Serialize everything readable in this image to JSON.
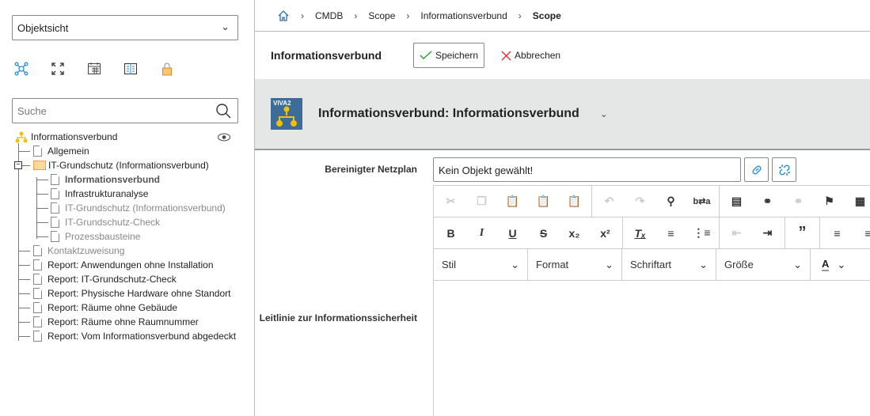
{
  "sidebar": {
    "view_select": "Objektsicht",
    "search_placeholder": "Suche",
    "tools": [
      "network-icon",
      "fullscreen-icon",
      "calendar-icon",
      "book-icon",
      "lock-icon"
    ],
    "tree": {
      "root": "Informationsverbund",
      "items": [
        {
          "label": "Allgemein",
          "level": 1,
          "style": "normal"
        },
        {
          "label": "IT-Grundschutz (Informationsverbund)",
          "level": 1,
          "style": "folder"
        },
        {
          "label": "Informationsverbund",
          "level": 2,
          "style": "bold"
        },
        {
          "label": "Infrastrukturanalyse",
          "level": 2,
          "style": "normal"
        },
        {
          "label": "IT-Grundschutz (Informationsverbund)",
          "level": 2,
          "style": "gray"
        },
        {
          "label": "IT-Grundschutz-Check",
          "level": 2,
          "style": "gray"
        },
        {
          "label": "Prozessbausteine",
          "level": 2,
          "style": "gray"
        },
        {
          "label": "Kontaktzuweisung",
          "level": 1,
          "style": "gray"
        },
        {
          "label": "Report: Anwendungen ohne Installation",
          "level": 1,
          "style": "normal"
        },
        {
          "label": "Report: IT-Grundschutz-Check",
          "level": 1,
          "style": "normal"
        },
        {
          "label": "Report: Physische Hardware ohne Standort",
          "level": 1,
          "style": "normal"
        },
        {
          "label": "Report: Räume ohne Gebäude",
          "level": 1,
          "style": "normal"
        },
        {
          "label": "Report: Räume ohne Raumnummer",
          "level": 1,
          "style": "normal"
        },
        {
          "label": "Report: Vom Informationsverbund abgedeckt",
          "level": 1,
          "style": "normal"
        }
      ]
    }
  },
  "breadcrumb": [
    "CMDB",
    "Scope",
    "Informationsverbund",
    "Scope"
  ],
  "toolbar": {
    "title": "Informationsverbund",
    "save": "Speichern",
    "cancel": "Abbrechen"
  },
  "header": {
    "logo_text": "VIVA2",
    "title": "Informationsverbund: Informationsverbund"
  },
  "form": {
    "netzplan_label": "Bereinigter Netzplan",
    "netzplan_value": "Kein Objekt gewählt!",
    "leitlinie_label": "Leitlinie zur Informationssicherheit"
  },
  "editor": {
    "dropdowns": [
      "Stil",
      "Format",
      "Schriftart",
      "Größe"
    ],
    "font_color": "A"
  },
  "colors": {
    "accent": "#2a8fd6",
    "header_bg": "#e5e7e6",
    "folder": "#f0a04b"
  }
}
